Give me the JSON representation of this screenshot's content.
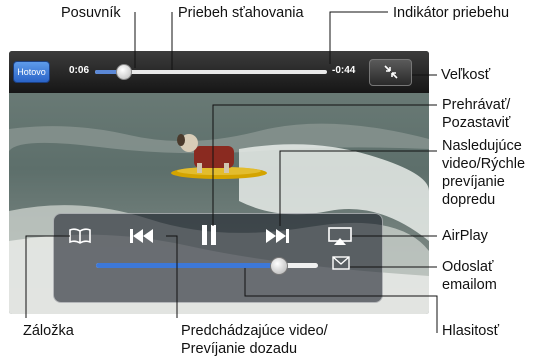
{
  "callouts": {
    "slider": "Posuvník",
    "download_progress": "Priebeh sťahovania",
    "progress_indicator": "Indikátor priebehu",
    "size": "Veľkosť",
    "play_pause_line1": "Prehrávať/",
    "play_pause_line2": "Pozastaviť",
    "next_line1": "Nasledujúce",
    "next_line2": "video/Rýchle",
    "next_line3": "prevíjanie",
    "next_line4": "dopredu",
    "airplay": "AirPlay",
    "send_email_line1": "Odoslať",
    "send_email_line2": "emailom",
    "bookmark": "Záložka",
    "previous_line1": "Predchádzajúce video/",
    "previous_line2": "Prevíjanie dozadu",
    "volume": "Hlasitosť"
  },
  "player": {
    "done_label": "Hotovo",
    "elapsed": "0:06",
    "remaining": "-0:44",
    "playback_progress": 0.12,
    "download_progress": 1.0,
    "volume_level": 0.82,
    "size_icon": "shrink-arrows-icon"
  },
  "controls": {
    "bookmark_icon": "book-icon",
    "previous_icon": "skip-back-icon",
    "play_pause_icon": "pause-icon",
    "next_icon": "skip-forward-icon",
    "airplay_icon": "airplay-icon",
    "email_icon": "envelope-icon"
  },
  "colors": {
    "done_button": "#3e7ee0",
    "progress_fill": "#5b88d6",
    "volume_fill": "#3d78d8"
  }
}
